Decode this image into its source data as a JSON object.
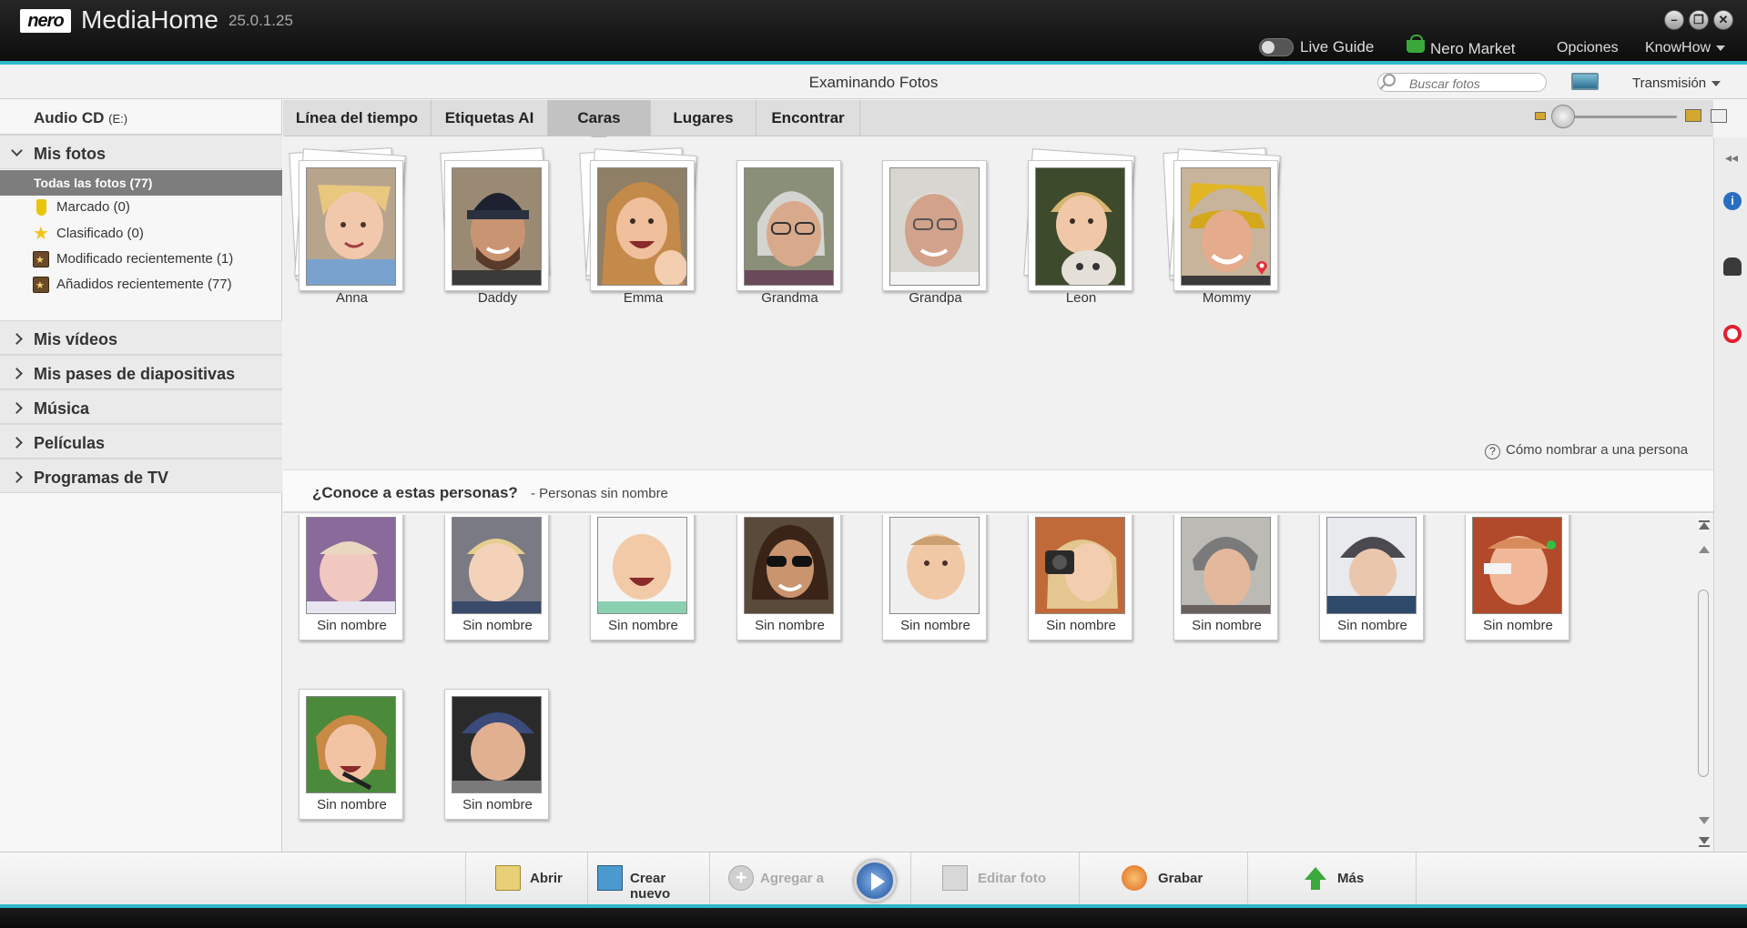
{
  "app": {
    "logo": "nero",
    "name": "MediaHome",
    "version": "25.0.1.25"
  },
  "titlebar": {
    "live_guide": "Live Guide",
    "market": "Nero Market",
    "options": "Opciones",
    "knowhow": "KnowHow"
  },
  "subheader": {
    "title": "Examinando Fotos",
    "search_placeholder": "Buscar fotos",
    "transmision": "Transmisión"
  },
  "sidebar": {
    "audio_cd": "Audio CD",
    "audio_cd_drive": "(E:)",
    "mis_fotos": "Mis fotos",
    "todas": "Todas las fotos (77)",
    "items": [
      {
        "label": "Marcado (0)",
        "icon": "marked-icon"
      },
      {
        "label": "Clasificado (0)",
        "icon": "star-icon"
      },
      {
        "label": "Modificado recientemente (1)",
        "icon": "album-icon"
      },
      {
        "label": "Añadidos recientemente (77)",
        "icon": "album-icon"
      }
    ],
    "sections": [
      "Mis vídeos",
      "Mis pases de diapositivas",
      "Música",
      "Películas",
      "Programas de TV"
    ]
  },
  "tabs": [
    "Línea del tiempo",
    "Etiquetas AI",
    "Caras",
    "Lugares",
    "Encontrar"
  ],
  "active_tab": "Caras",
  "named_faces": [
    "Anna",
    "Daddy",
    "Emma",
    "Grandma",
    "Grandpa",
    "Leon",
    "Mommy"
  ],
  "help_link": "Cómo nombrar a una persona",
  "unknown": {
    "question": "¿Conoce a estas personas?",
    "subtitle": "- Personas sin nombre",
    "label": "Sin nombre",
    "count": 11
  },
  "bottom": {
    "abrir": "Abrir",
    "crear": "Crear nuevo",
    "agregar": "Agregar a",
    "editar": "Editar foto",
    "grabar": "Grabar",
    "mas": "Más"
  },
  "colors": {
    "accent": "#2bb8c9",
    "selected_nav": "#7d7d7d",
    "active_tab": "#c2c2c2"
  }
}
